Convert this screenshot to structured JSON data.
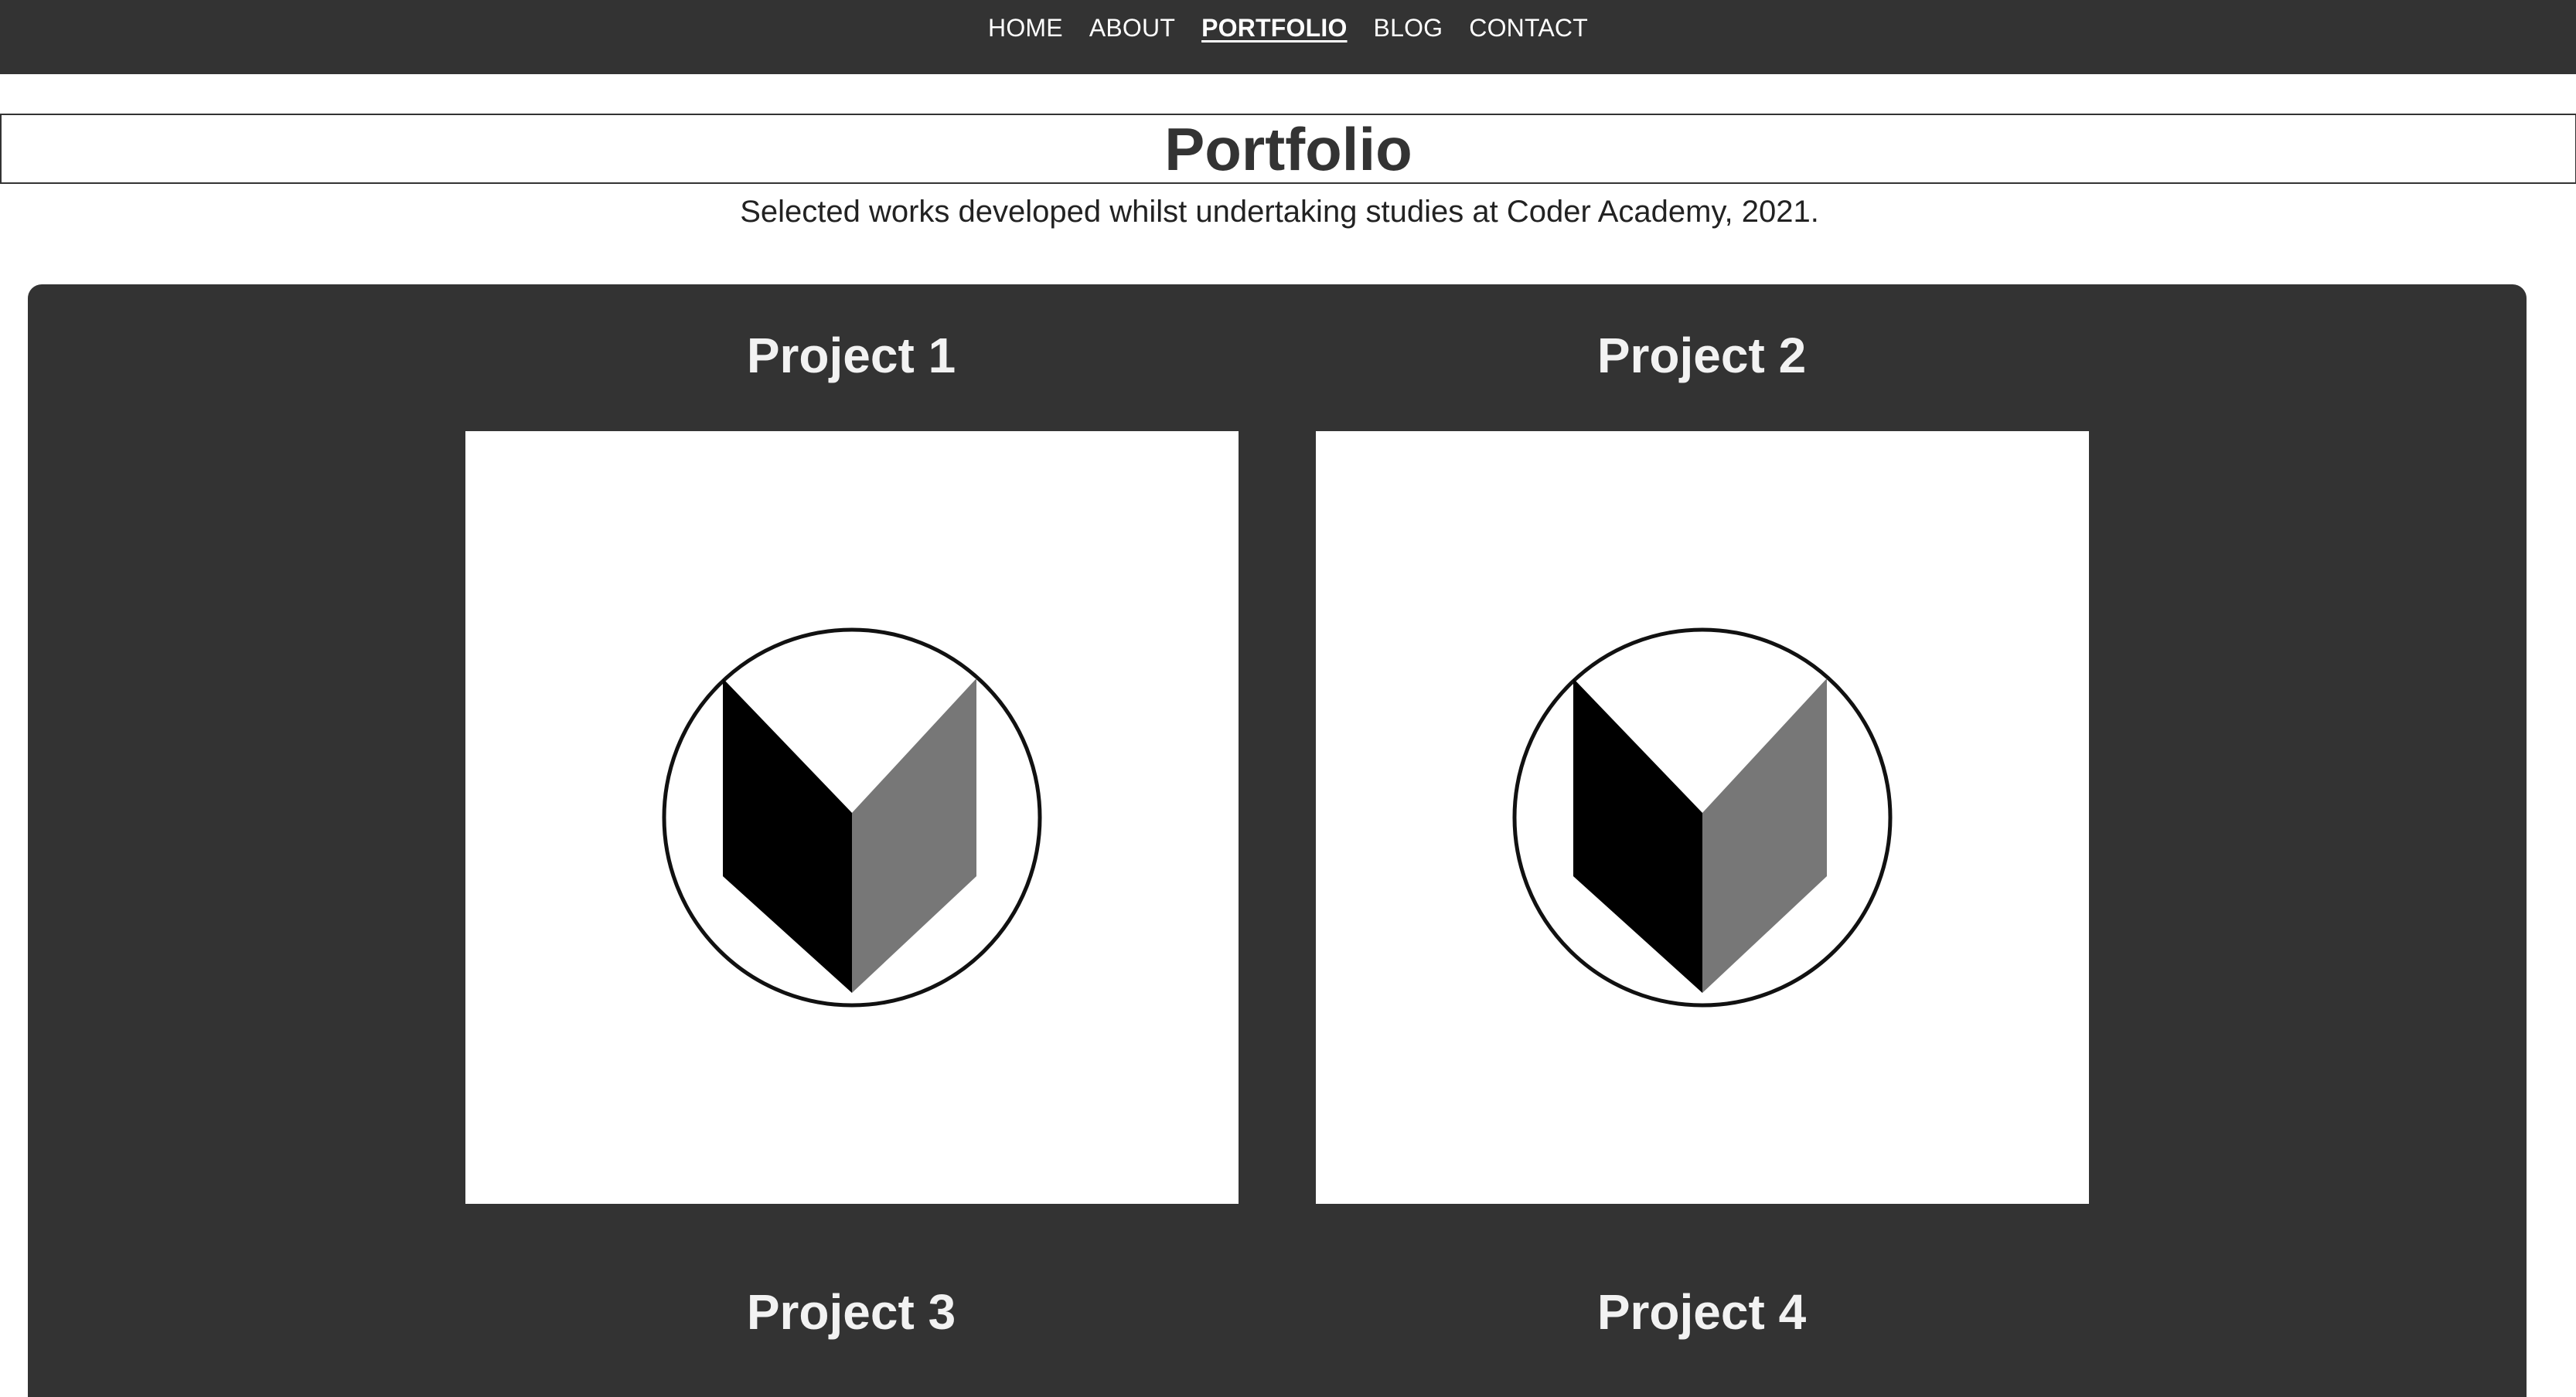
{
  "nav": {
    "items": [
      {
        "label": "HOME",
        "active": false
      },
      {
        "label": "ABOUT",
        "active": false
      },
      {
        "label": "PORTFOLIO",
        "active": true
      },
      {
        "label": "BLOG",
        "active": false
      },
      {
        "label": "CONTACT",
        "active": false
      }
    ]
  },
  "page": {
    "title": "Portfolio",
    "subtitle": "Selected works developed whilst undertaking studies at Coder Academy, 2021."
  },
  "projects": [
    {
      "title": "Project 1",
      "icon": "chevron-logo-icon"
    },
    {
      "title": "Project 2",
      "icon": "chevron-logo-icon"
    },
    {
      "title": "Project 3",
      "icon": "chevron-logo-icon"
    },
    {
      "title": "Project 4",
      "icon": "chevron-logo-icon"
    }
  ],
  "colors": {
    "nav_bg": "#333333",
    "gallery_bg": "#333333",
    "logo_dark": "#000000",
    "logo_light": "#777777"
  }
}
